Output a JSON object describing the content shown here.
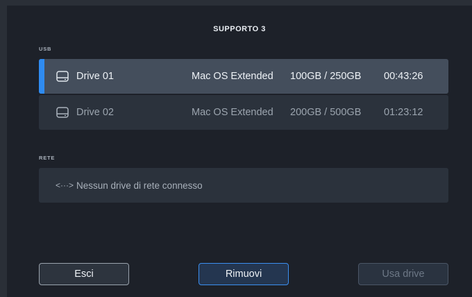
{
  "dialog": {
    "title": "SUPPORTO 3"
  },
  "usb": {
    "label": "USB",
    "drives": [
      {
        "name": "Drive 01",
        "format": "Mac OS Extended",
        "capacity": "100GB / 250GB",
        "time": "00:43:26",
        "selected": true
      },
      {
        "name": "Drive 02",
        "format": "Mac OS Extended",
        "capacity": "200GB / 500GB",
        "time": "01:23:12",
        "selected": false
      }
    ]
  },
  "network": {
    "label": "RETE",
    "icon": "<···>",
    "empty_text": "Nessun drive di rete connesso"
  },
  "buttons": {
    "exit": "Esci",
    "remove": "Rimuovi",
    "use_drive": "Usa drive"
  },
  "colors": {
    "accent": "#2f8bf0",
    "selected_row": "#444e5c",
    "row": "#2b323c",
    "background": "#1d2129"
  }
}
